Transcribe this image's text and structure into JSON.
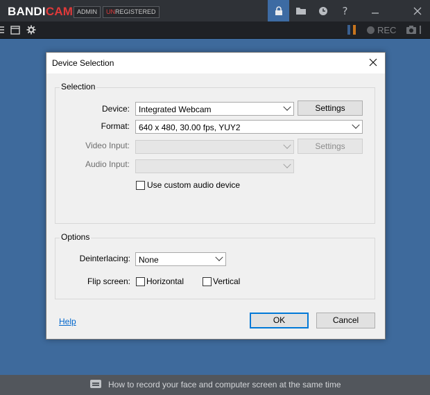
{
  "app": {
    "logo_part1": "BANDI",
    "logo_part2": "CAM",
    "badge_admin": "ADMIN",
    "badge_unreg_prefix": "UN",
    "badge_unreg_rest": "REGISTERED",
    "icons": [
      "lock-icon",
      "folder-icon",
      "clock-icon",
      "help-icon",
      "minimize-icon",
      "close-icon"
    ]
  },
  "toolbar": {
    "rec_label": "REC",
    "colors": {
      "accent": "#3d6ba3",
      "brand_red": "#e03a3a"
    }
  },
  "dialog": {
    "title": "Device Selection",
    "selection": {
      "group_label": "Selection",
      "device_label": "Device:",
      "device_value": "Integrated Webcam",
      "device_settings": "Settings",
      "format_label": "Format:",
      "format_value": "640 x 480, 30.00 fps, YUY2",
      "video_input_label": "Video Input:",
      "video_input_value": "",
      "video_settings": "Settings",
      "audio_input_label": "Audio Input:",
      "audio_input_value": "",
      "custom_audio_label": "Use custom audio device",
      "custom_audio_checked": false
    },
    "options": {
      "group_label": "Options",
      "deinterlacing_label": "Deinterlacing:",
      "deinterlacing_value": "None",
      "flip_label": "Flip screen:",
      "horizontal_label": "Horizontal",
      "horizontal_checked": false,
      "vertical_label": "Vertical",
      "vertical_checked": false
    },
    "help": "Help",
    "ok": "OK",
    "cancel": "Cancel"
  },
  "bottom": {
    "hint": "How to record your face and computer screen at the same time"
  }
}
